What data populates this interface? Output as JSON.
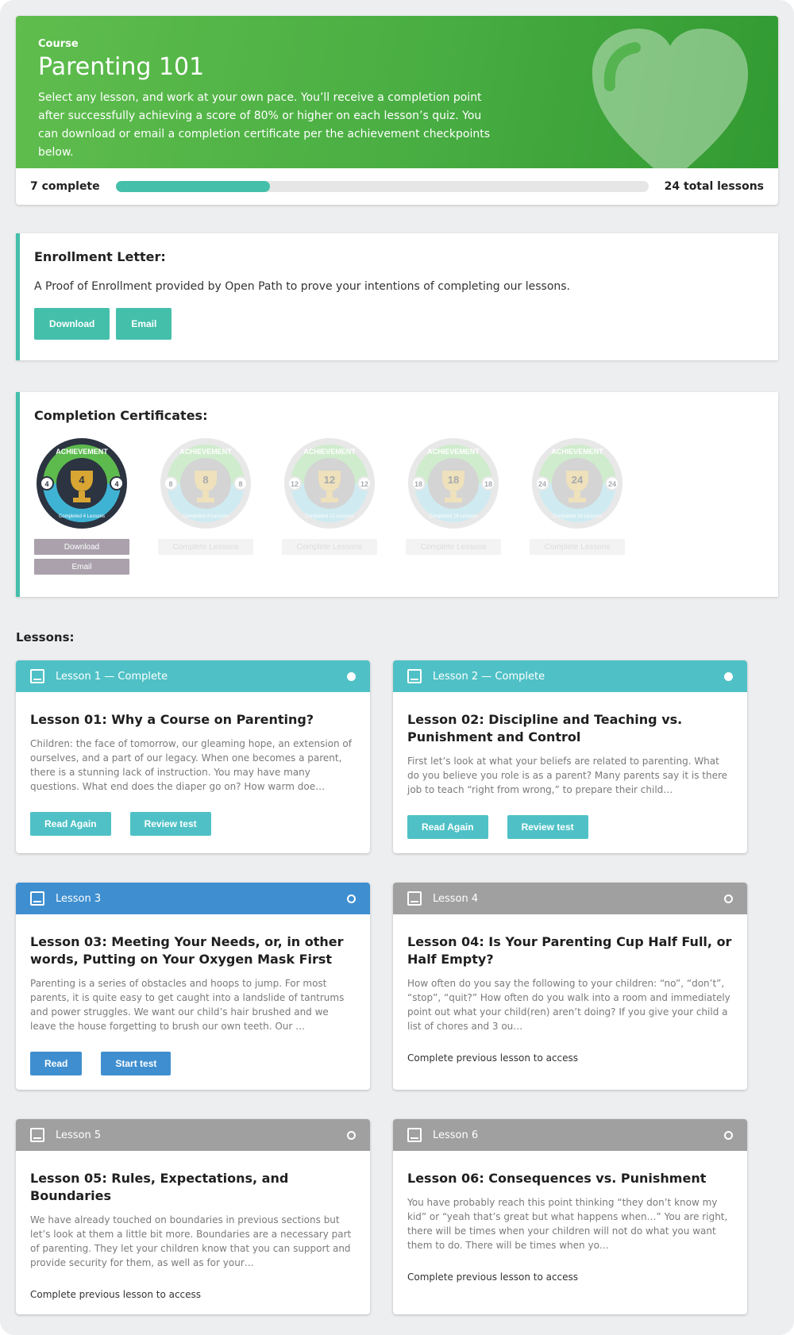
{
  "course": {
    "eyebrow": "Course",
    "title": "Parenting 101",
    "description": "Select any lesson, and work at your own pace. You’ll receive a completion point after successfully achieving a score of 80% or higher on each lesson’s quiz. You can download or email a completion certificate per the achievement checkpoints below.",
    "complete_label": "7 complete",
    "total_label": "24 total lessons",
    "progress_fraction": 0.29,
    "accent_color": "#44bfaa",
    "hero_color": "#4cb046"
  },
  "enrollment": {
    "title": "Enrollment Letter:",
    "text": "A Proof of Enrollment provided by Open Path to prove your intentions of completing our lessons.",
    "download_label": "Download",
    "email_label": "Email"
  },
  "certificates": {
    "title": "Completion Certificates:",
    "badges": [
      {
        "count": "4",
        "arc_text": "ACHIEVEMENT",
        "sub_text": "Completed 4 Lessons",
        "earned": true,
        "download_label": "Download",
        "email_label": "Email"
      },
      {
        "count": "8",
        "arc_text": "ACHIEVEMENT",
        "sub_text": "Completed 8 Lessons",
        "earned": false,
        "locked_label": "Complete Lessons"
      },
      {
        "count": "12",
        "arc_text": "ACHIEVEMENT",
        "sub_text": "Completed 12 Lessons",
        "earned": false,
        "locked_label": "Complete Lessons"
      },
      {
        "count": "18",
        "arc_text": "ACHIEVEMENT",
        "sub_text": "Completed 18 Lessons",
        "earned": false,
        "locked_label": "Complete Lessons"
      },
      {
        "count": "24",
        "arc_text": "ACHIEVEMENT",
        "sub_text": "Completed 24 Lessons",
        "earned": false,
        "locked_label": "Complete Lessons"
      }
    ]
  },
  "lessons": {
    "heading": "Lessons:",
    "items": [
      {
        "header": "Lesson 1 — Complete",
        "title": "Lesson 01: Why a Course on Parenting?",
        "excerpt": "Children: the face of tomorrow, our gleaming hope, an extension of ourselves, and a part of our legacy. When one becomes a parent, there is a stunning lack of instruction. You may have many questions. What end does the diaper go on? How warm doe…",
        "primary_label": "Read Again",
        "secondary_label": "Review test"
      },
      {
        "header": "Lesson 2 — Complete",
        "title": "Lesson 02: Discipline and Teaching vs. Punishment and Control",
        "excerpt": "First let’s look at what your beliefs are related to parenting. What do you believe you role is as a parent? Many parents say it is there job to teach “right from wrong,” to prepare their child…",
        "primary_label": "Read Again",
        "secondary_label": "Review test"
      },
      {
        "header": "Lesson 3",
        "title": "Lesson 03: Meeting Your Needs, or, in other words, Putting on Your Oxygen Mask First",
        "excerpt": "Parenting is a series of obstacles and hoops to jump. For most parents, it is quite easy to get caught into a landslide of tantrums and power struggles. We want our child’s hair brushed and we leave the house forgetting to brush our own teeth. Our …",
        "primary_label": "Read",
        "secondary_label": "Start test"
      },
      {
        "header": "Lesson 4",
        "title": "Lesson 04: Is Your Parenting Cup Half Full, or Half Empty?",
        "excerpt": "How often do you say the following to your children: “no”, “don’t”, “stop”, “quit?” How often do you walk into a room and immediately point out what your child(ren) aren’t doing? If you give your child a list of chores and 3 ou…",
        "locked_note": "Complete previous lesson to access"
      },
      {
        "header": "Lesson 5",
        "title": "Lesson 05: Rules, Expectations, and Boundaries",
        "excerpt": "We have already touched on boundaries in previous sections but let’s look at them a little bit more. Boundaries are a necessary part of parenting. They let your children know that you can support and provide security for them, as well as for your…",
        "locked_note": "Complete previous lesson to access"
      },
      {
        "header": "Lesson 6",
        "title": "Lesson 06: Consequences vs. Punishment",
        "excerpt": "You have probably reach this point thinking “they don’t know my kid” or “yeah that’s great but what happens when…” You are right, there will be times when your children will not do what you want them to do. There will be times when yo…",
        "locked_note": "Complete previous lesson to access"
      }
    ]
  }
}
